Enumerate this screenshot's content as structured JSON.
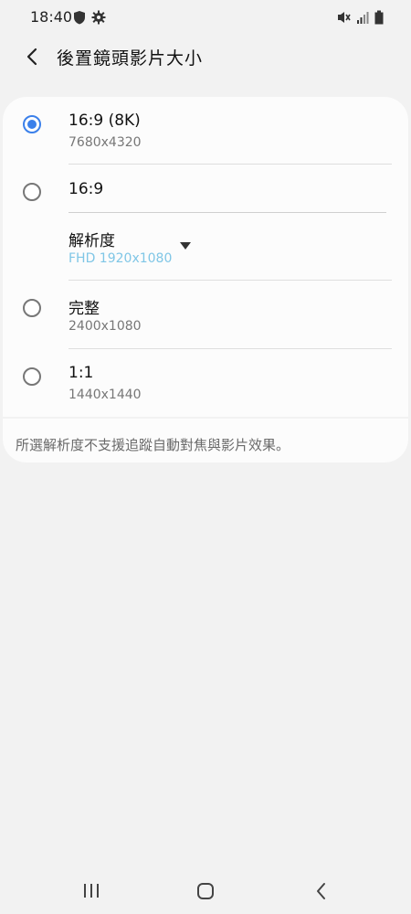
{
  "status_bar": {
    "time": "18:40",
    "left_icons": [
      "shield-icon",
      "gear-icon"
    ],
    "right_icons": [
      "mute-icon",
      "signal-icon",
      "battery-icon"
    ]
  },
  "header": {
    "title": "後置鏡頭影片大小"
  },
  "options": [
    {
      "label": "16:9 (8K)",
      "sub": "7680x4320",
      "selected": true
    },
    {
      "label": "16:9",
      "sub": "",
      "selected": false
    },
    {
      "label": "完整",
      "sub": "2400x1080",
      "selected": false
    },
    {
      "label": "1:1",
      "sub": "1440x1440",
      "selected": false
    }
  ],
  "resolution": {
    "label": "解析度",
    "value": "FHD 1920x1080"
  },
  "footer_note": "所選解析度不支援追蹤自動對焦與影片效果。",
  "colors": {
    "accent": "#3b80ea",
    "secondary_value": "#7fc6e6",
    "background": "#f2f2f2",
    "card": "#fcfcfc"
  },
  "nav_bar": {
    "icons": [
      "recents-icon",
      "home-icon",
      "back-icon"
    ]
  }
}
